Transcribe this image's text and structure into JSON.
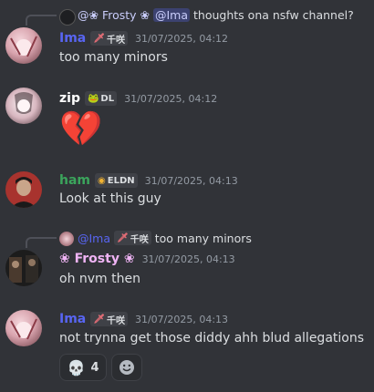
{
  "messages": [
    {
      "reply": {
        "author": "@❀ Frosty ❀",
        "mention": "@Ima",
        "text": "thoughts ona nsfw channel?"
      },
      "author": "Ima",
      "author_color": "#5865f2",
      "tag": "千咲",
      "timestamp": "31/07/2025, 04:12",
      "text": "too many minors"
    },
    {
      "author": "zip",
      "author_color": "#ffffff",
      "tag": "DL",
      "timestamp": "31/07/2025, 04:12",
      "emoji": "💔"
    },
    {
      "author": "ham",
      "author_color": "#3ba55c",
      "tag": "ELDN",
      "timestamp": "31/07/2025, 04:13",
      "text": "Look at this guy"
    },
    {
      "reply": {
        "author": "@Ima",
        "tag": "千咲",
        "text": "too many minors"
      },
      "author": "❀ Frosty ❀",
      "author_color": "#f0b4f5",
      "timestamp": "31/07/2025, 04:13",
      "text": "oh nvm then"
    },
    {
      "author": "Ima",
      "author_color": "#5865f2",
      "tag": "千咲",
      "timestamp": "31/07/2025, 04:13",
      "text": "not trynna get those diddy ahh blud allegations",
      "reactions": [
        {
          "emoji": "💀",
          "count": "4"
        }
      ]
    }
  ],
  "icons": {
    "add_reaction": "smiley-icon",
    "tag_sword": "sword-icon",
    "tag_frog": "frog-icon",
    "tag_eye": "eye-icon"
  }
}
